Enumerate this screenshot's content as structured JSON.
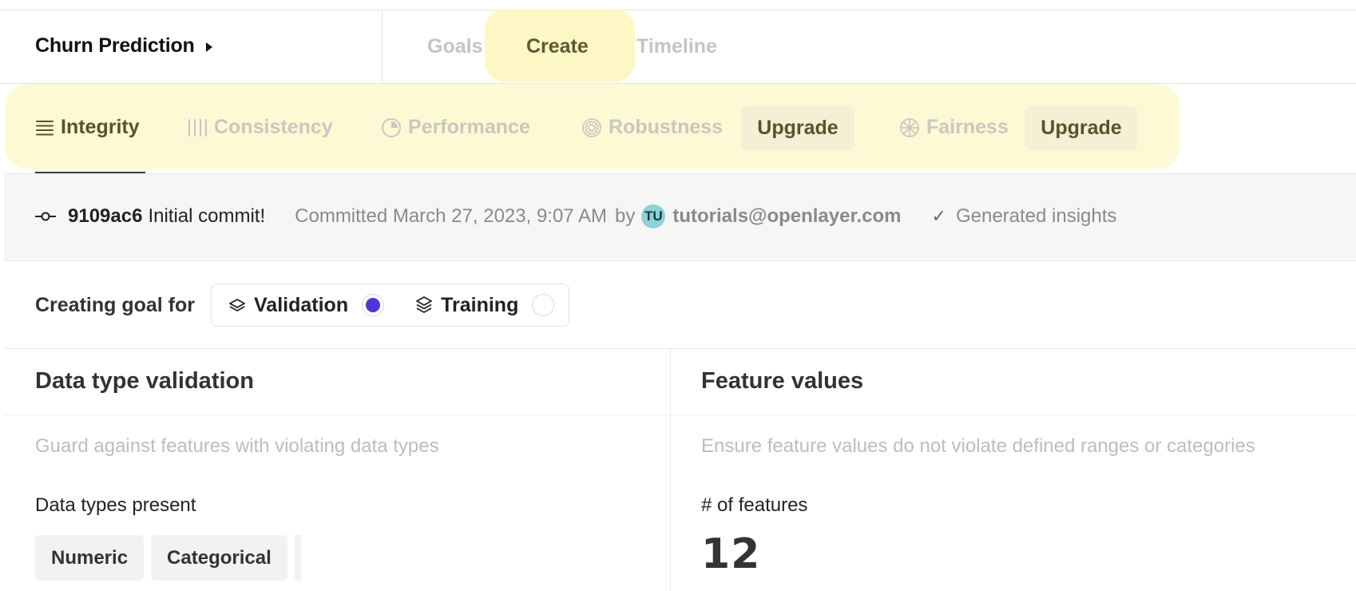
{
  "project": {
    "title": "Churn Prediction"
  },
  "main_tabs": {
    "goals": "Goals",
    "create": "Create",
    "timeline": "Timeline"
  },
  "subtabs": {
    "integrity": "Integrity",
    "consistency": "Consistency",
    "performance": "Performance",
    "robustness": "Robustness",
    "fairness": "Fairness",
    "upgrade": "Upgrade",
    "active": "Integrity"
  },
  "commit": {
    "hash": "9109ac6",
    "message": "Initial commit!",
    "committed": "Committed March 27, 2023, 9:07 AM",
    "by": "by",
    "avatar_initials": "TU",
    "email": "tutorials@openlayer.com",
    "status": "Generated insights"
  },
  "goal_target": {
    "label": "Creating goal for",
    "options": [
      {
        "label": "Validation",
        "selected": true
      },
      {
        "label": "Training",
        "selected": false
      }
    ]
  },
  "cards": {
    "data_type": {
      "title": "Data type validation",
      "description": "Guard against features with violating data types",
      "subheading": "Data types present",
      "chips": [
        "Numeric",
        "Categorical"
      ]
    },
    "feature_values": {
      "title": "Feature values",
      "description": "Ensure feature values do not violate defined ranges or categories",
      "subheading": "# of features",
      "value": "12"
    }
  },
  "colors": {
    "highlight": "#fdf7c6",
    "accent_olive": "#57542c",
    "radio_selected": "#4f35d6",
    "avatar_bg": "#8ed1d6"
  },
  "icons": {
    "integrity": "list-lines-icon",
    "consistency": "bars-icon",
    "performance": "pie-icon",
    "robustness": "target-icon",
    "fairness": "wheel-icon",
    "commit": "commit-icon",
    "check": "check-icon",
    "layers": "layers-icon"
  }
}
